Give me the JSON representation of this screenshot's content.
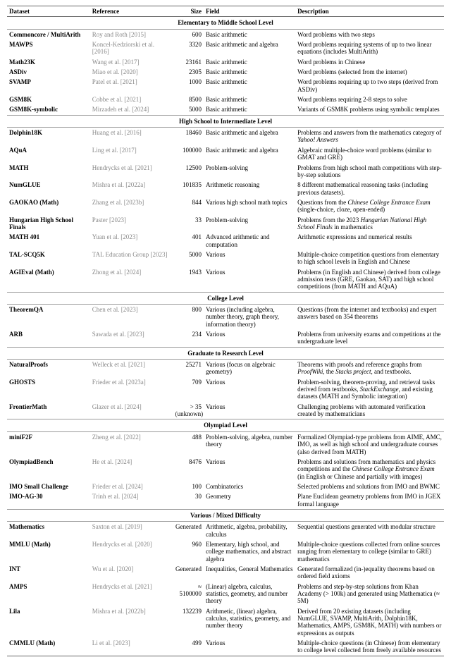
{
  "headers": {
    "dataset": "Dataset",
    "reference": "Reference",
    "size": "Size",
    "field": "Field",
    "description": "Description"
  },
  "sections": [
    {
      "title": "Elementary to Middle School Level",
      "rows": [
        {
          "dataset": "Commoncore / MultiArith",
          "reference": "Roy and Roth [2015]",
          "size": "600",
          "field": "Basic arithmetic",
          "desc": "Word problems with two steps"
        },
        {
          "dataset": "MAWPS",
          "reference": "Koncel-Kedziorski et al. [2016]",
          "size": "3320",
          "field": "Basic arithmetic and algebra",
          "desc": "Word problems requiring systems of up to two linear equations (includes MultiArith)"
        },
        {
          "dataset": "Math23K",
          "reference": "Wang et al. [2017]",
          "size": "23161",
          "field": "Basic arithmetic",
          "desc": "Word problems in Chinese"
        },
        {
          "dataset": "ASDiv",
          "reference": "Miao et al. [2020]",
          "size": "2305",
          "field": "Basic arithmetic",
          "desc": "Word problems (selected from the internet)"
        },
        {
          "dataset": "SVAMP",
          "reference": "Patel et al. [2021]",
          "size": "1000",
          "field": "Basic arithmetic",
          "desc": "Word problems requiring up to two steps (derived from ASDiv)"
        },
        {
          "dataset": "GSM8K",
          "reference": "Cobbe et al. [2021]",
          "size": "8500",
          "field": "Basic arithmetic",
          "desc": "Word problems requiring 2-8 steps to solve"
        },
        {
          "dataset": "GSM8K-symbolic",
          "reference": "Mirzadeh et al. [2024]",
          "size": "5000",
          "field": "Basic arithmetic",
          "desc": "Variants of GSM8K problems using symbolic templates"
        }
      ]
    },
    {
      "title": "High School to Intermediate Level",
      "rows": [
        {
          "dataset": "Dolphin18K",
          "reference": "Huang et al. [2016]",
          "size": "18460",
          "field": "Basic arithmetic and algebra",
          "desc": "Problems and answers from the mathematics category of <i>Yahoo! Answers</i>"
        },
        {
          "dataset": "AQuA",
          "reference": "Ling et al. [2017]",
          "size": "100000",
          "field": "Basic arithmetic and algebra",
          "desc": "Algebraic multiple-choice word problems (similar to GMAT and GRE)"
        },
        {
          "dataset": "MATH",
          "reference": "Hendrycks et al. [2021]",
          "size": "12500",
          "field": "Problem-solving",
          "desc": "Problems from high school math competitions with step-by-step solutions"
        },
        {
          "dataset": "NumGLUE",
          "reference": "Mishra et al. [2022a]",
          "size": "101835",
          "field": "Arithmetic reasoning",
          "desc": "8 different mathematical reasoning tasks (including previous datasets)."
        },
        {
          "dataset": "GAOKAO (Math)",
          "reference": "Zhang et al. [2023b]",
          "size": "844",
          "field": "Various high school math topics",
          "desc": "Questions from the <i>Chinese College Entrance Exam</i> (single-choice, cloze, open-ended)"
        },
        {
          "dataset": "Hungarian High School Finals",
          "reference": "Paster [2023]",
          "size": "33",
          "field": "Problem-solving",
          "desc": "Problems from the 2023 <i>Hungarian National High School Finals</i> in mathematics"
        },
        {
          "dataset": "MATH 401",
          "reference": "Yuan et al. [2023]",
          "size": "401",
          "field": "Advanced arithmetic and computation",
          "desc": "Arithmetic expressions and numerical results"
        },
        {
          "dataset": "TAL-SCQ5K",
          "reference": "TAL Education Group [2023]",
          "size": "5000",
          "field": "Various",
          "desc": "Multiple-choice competition questions from elementary to high school levels in English and Chinese"
        },
        {
          "dataset": "AGIEval (Math)",
          "reference": "Zhong et al. [2024]",
          "size": "1943",
          "field": "Various",
          "desc": "Problems (in English and Chinese) derived from college admission tests (GRE, Gaokao, SAT) and high school competitions (from MATH and AQuA)"
        }
      ]
    },
    {
      "title": "College Level",
      "rows": [
        {
          "dataset": "TheoremQA",
          "reference": "Chen et al. [2023]",
          "size": "800",
          "field": "Various (including algebra, number theory, graph theory, information theory)",
          "desc": "Questions (from the internet and textbooks) and expert answers based on 354 theorems"
        },
        {
          "dataset": "ARB",
          "reference": "Sawada et al. [2023]",
          "size": "234",
          "field": "Various",
          "desc": "Problems from university exams and competitions at the undergraduate level"
        }
      ]
    },
    {
      "title": "Graduate to Research Level",
      "rows": [
        {
          "dataset": "NaturalProofs",
          "reference": "Welleck et al. [2021]",
          "size": "25271",
          "field": "Various (focus on algebraic geometry)",
          "desc": "Theorems with proofs and reference graphs from <i>ProofWiki</i>, the <i>Stacks project</i>, and textbooks."
        },
        {
          "dataset": "GHOSTS",
          "reference": "Frieder et al. [2023a]",
          "size": "709",
          "field": "Various",
          "desc": "Problem-solving, theorem-proving, and retrieval tasks derived from textbooks, <i>StackExchange</i>, and existing datasets (MATH and Symbolic integration)"
        },
        {
          "dataset": "FrontierMath",
          "reference": "Glazer et al. [2024]",
          "size": "> 35 (unknown)",
          "field": "Various",
          "desc": "Challenging problems with automated verification created by mathematicians"
        }
      ]
    },
    {
      "title": "Olympiad Level",
      "rows": [
        {
          "dataset": "miniF2F",
          "reference": "Zheng et al. [2022]",
          "size": "488",
          "field": "Problem-solving, algebra, number theory",
          "desc": "Formalized Olympiad-type problems from AIME, AMC, IMO, as well as high school and undergraduate courses (also derived from MATH)"
        },
        {
          "dataset": "OlympiadBench",
          "reference": "He et al. [2024]",
          "size": "8476",
          "field": "Various",
          "desc": "Problems and solutions from mathematics and physics competitions and the <i>Chinese College Entrance Exam</i> (in English or Chinese and partially with images)"
        },
        {
          "dataset": "IMO Small Challenge",
          "reference": "Frieder et al. [2024]",
          "size": "100",
          "field": "Combinatorics",
          "desc": "Selected problems and solutions from IMO and BWMC"
        },
        {
          "dataset": "IMO-AG-30",
          "reference": "Trinh et al. [2024]",
          "size": "30",
          "field": "Geometry",
          "desc": "Plane Euclidean geometry problems from IMO in JGEX formal language"
        }
      ]
    },
    {
      "title": "Various / Mixed Difficulty",
      "rows": [
        {
          "dataset": "Mathematics",
          "reference": "Saxton et al. [2019]",
          "size": "Generated",
          "field": "Arithmetic, algebra, probability, calculus",
          "desc": "Sequential questions generated with modular structure"
        },
        {
          "dataset": "MMLU (Math)",
          "reference": "Hendrycks et al. [2020]",
          "size": "960",
          "field": "Elementary, high school, and college mathematics, and abstract algebra",
          "desc": "Multiple-choice questions collected from online sources ranging from elementary to college (similar to GRE) mathematics"
        },
        {
          "dataset": "INT",
          "reference": "Wu et al. [2020]",
          "size": "Generated",
          "field": "Inequalities, General Mathematics",
          "desc": "Generated formalized (in-)equality theorems based on ordered field axioms"
        },
        {
          "dataset": "AMPS",
          "reference": "Hendrycks et al. [2021]",
          "size": "≈ 5100000",
          "field": "(Linear) algebra, calculus, statistics, geometry, and number theory",
          "desc": "Problems and step-by-step solutions from Khan Academy (> 100k) and generated using Mathematica (≈ 5M)"
        },
        {
          "dataset": "Lila",
          "reference": "Mishra et al. [2022b]",
          "size": "132239",
          "field": "Arithmetic, (linear) algebra, calculus, statistics, geometry, and number theory",
          "desc": "Derived from 20 existing datasets (including NumGLUE, SVAMP, MultiArith, Dolphin18K, Mathematics, AMPS, GSM8K, MATH) with numbers or expressions as outputs"
        },
        {
          "dataset": "CMMLU (Math)",
          "reference": "Li et al. [2023]",
          "size": "499",
          "field": "Various",
          "desc": "Multiple-choice questions (in Chinese) from elementary to college level collected from freely available resources"
        }
      ]
    }
  ]
}
